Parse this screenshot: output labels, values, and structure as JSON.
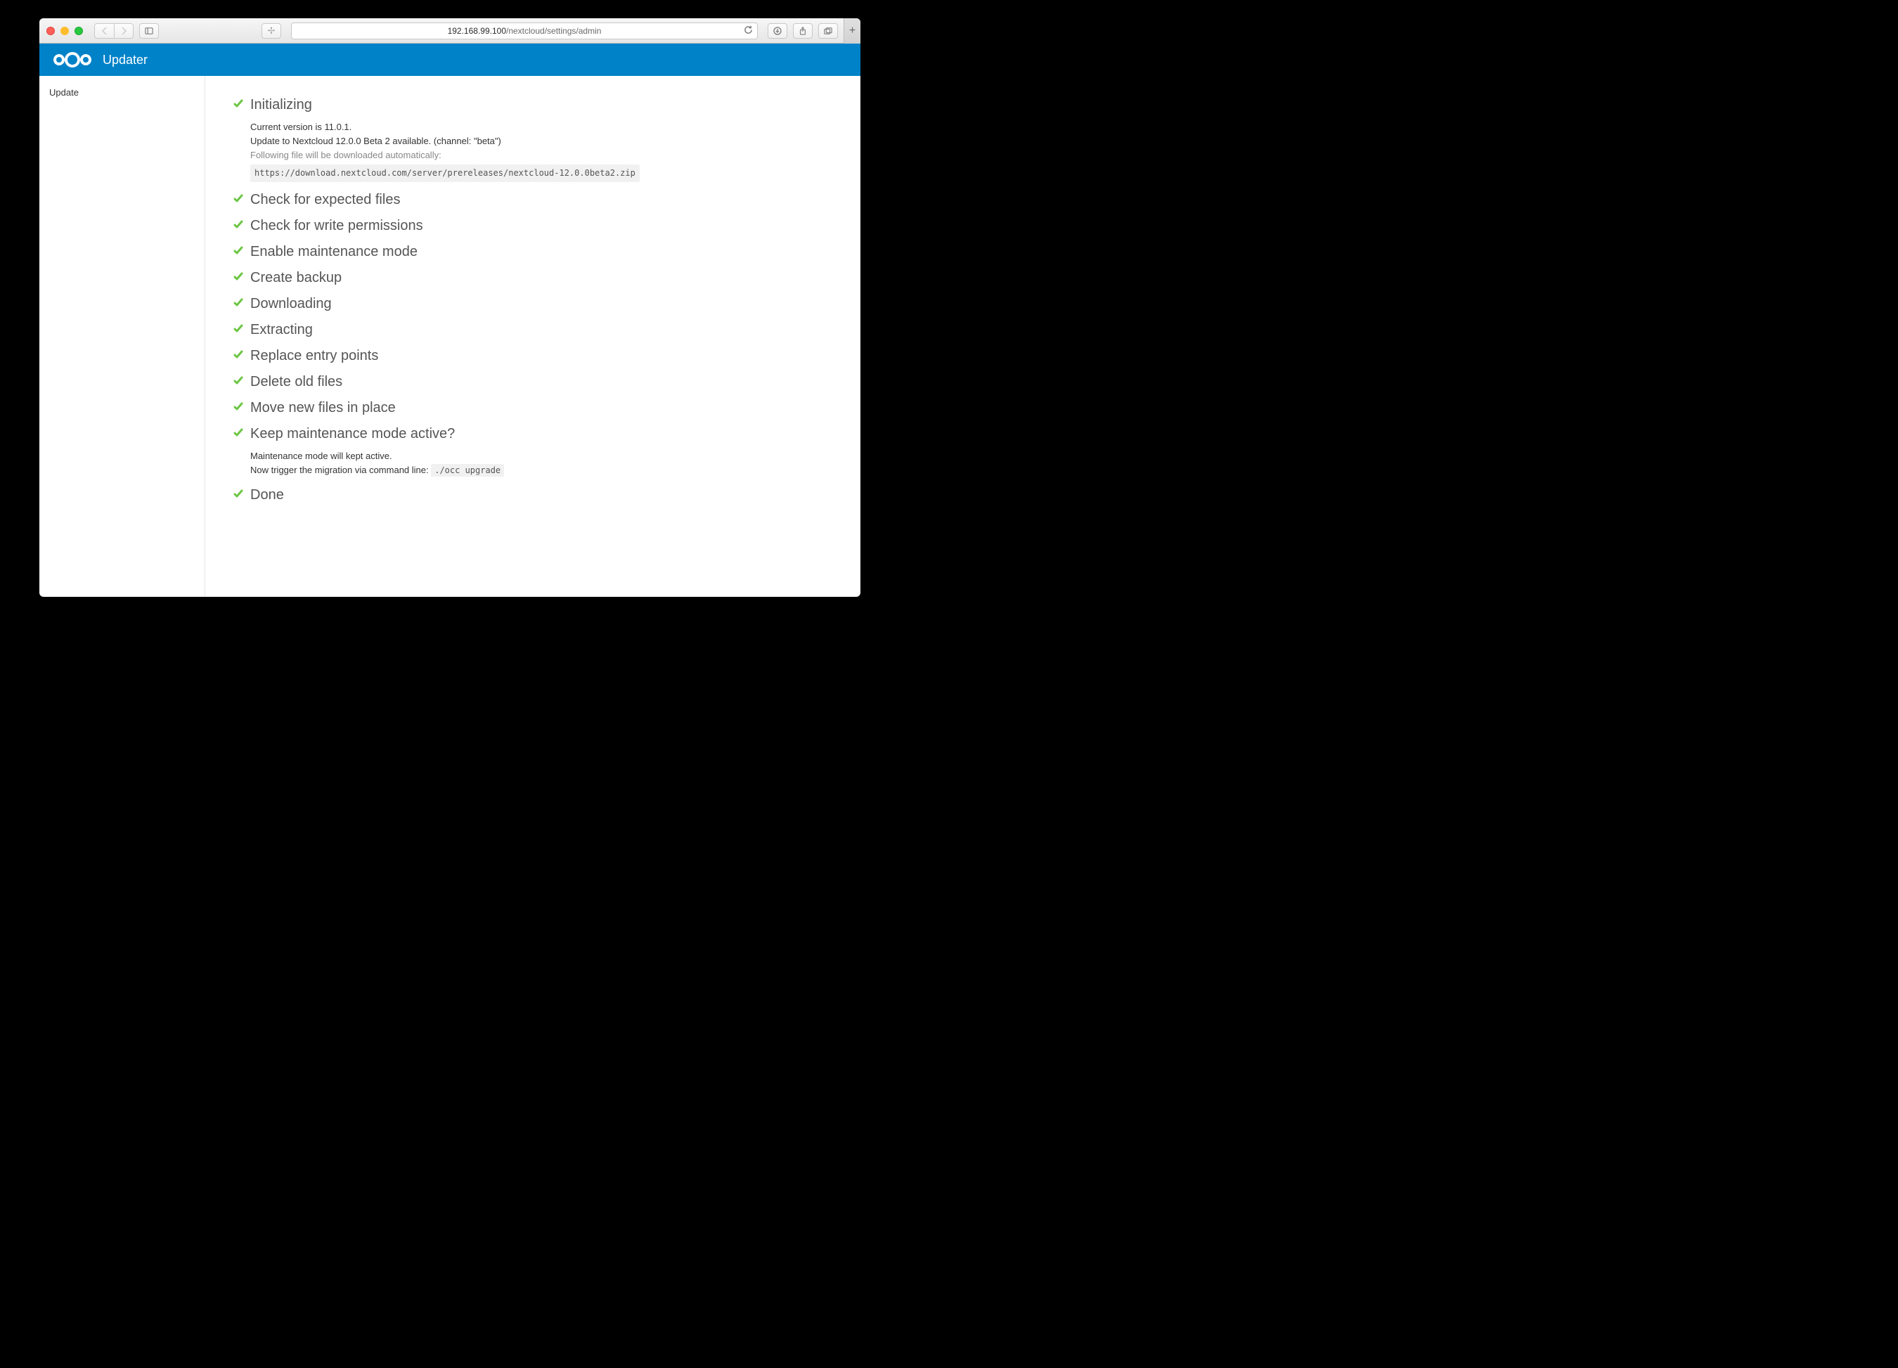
{
  "browser": {
    "url_host": "192.168.99.100",
    "url_path": "/nextcloud/settings/admin"
  },
  "header": {
    "app_title": "Updater"
  },
  "sidebar": {
    "items": [
      {
        "label": "Update"
      }
    ]
  },
  "steps": [
    {
      "title": "Initializing",
      "detail": {
        "current_version_line": "Current version is 11.0.1.",
        "update_available_line": "Update to Nextcloud 12.0.0 Beta 2 available. (channel: \"beta\")",
        "download_intro": "Following file will be downloaded automatically:",
        "download_url": "https://download.nextcloud.com/server/prereleases/nextcloud-12.0.0beta2.zip"
      }
    },
    {
      "title": "Check for expected files"
    },
    {
      "title": "Check for write permissions"
    },
    {
      "title": "Enable maintenance mode"
    },
    {
      "title": "Create backup"
    },
    {
      "title": "Downloading"
    },
    {
      "title": "Extracting"
    },
    {
      "title": "Replace entry points"
    },
    {
      "title": "Delete old files"
    },
    {
      "title": "Move new files in place"
    },
    {
      "title": "Keep maintenance mode active?",
      "detail": {
        "line1": "Maintenance mode will kept active.",
        "line2_prefix": "Now trigger the migration via command line: ",
        "line2_code": "./occ upgrade"
      }
    },
    {
      "title": "Done"
    }
  ]
}
